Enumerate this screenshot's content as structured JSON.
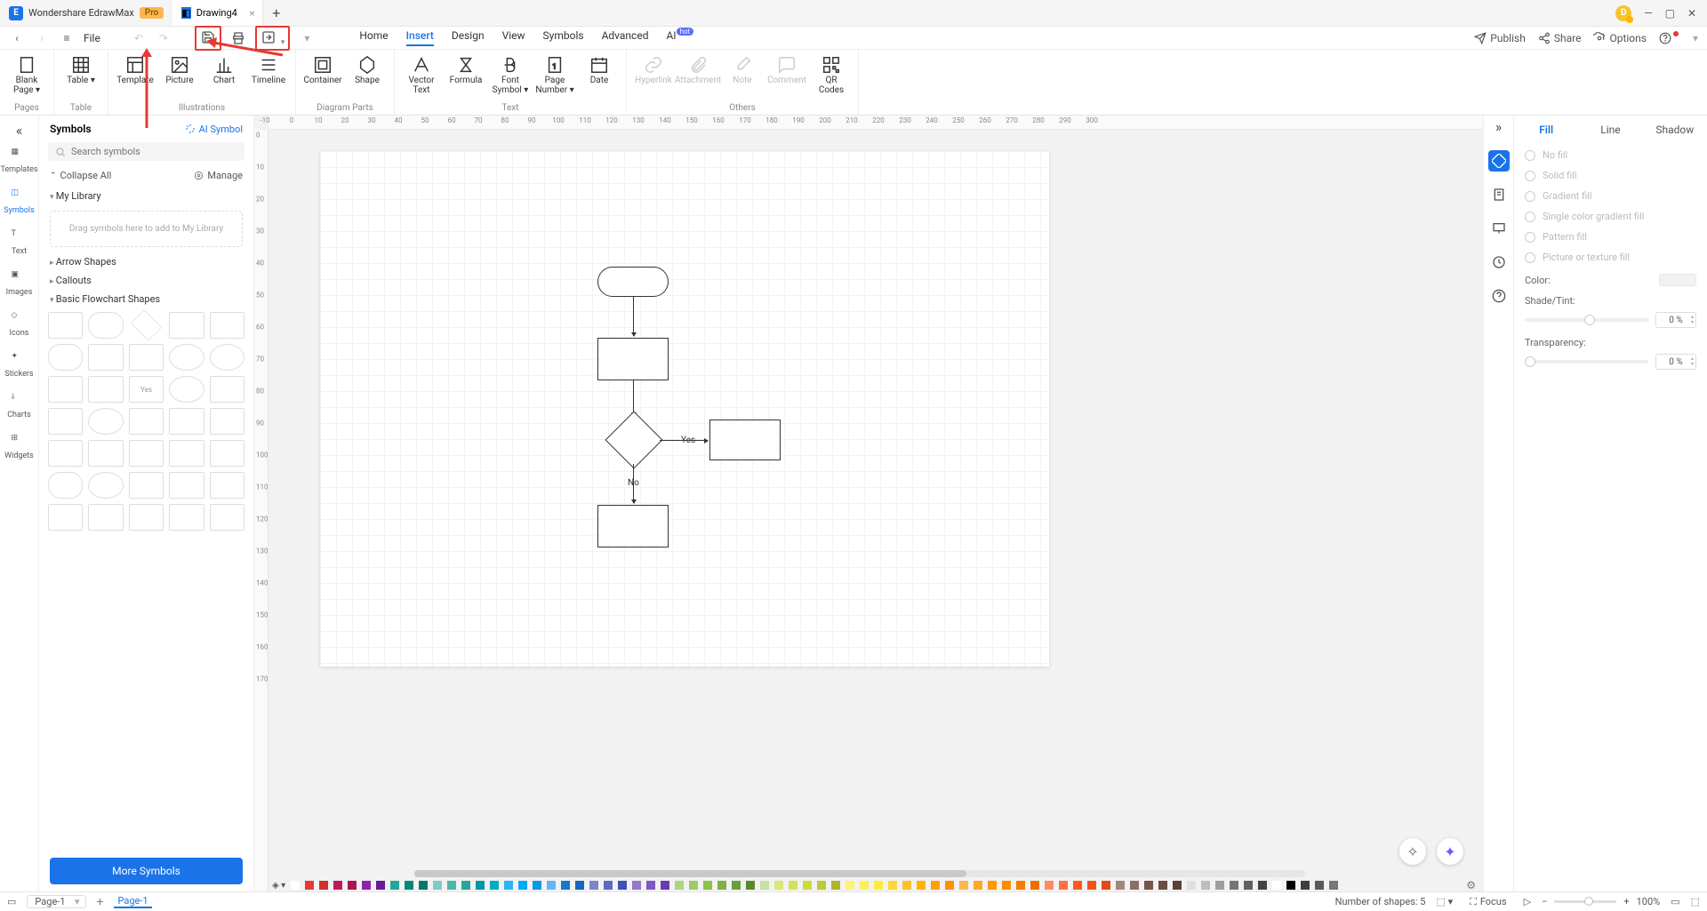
{
  "titlebar": {
    "app_name": "Wondershare EdrawMax",
    "pro_badge": "Pro",
    "doc_tab": "Drawing4",
    "avatar_initial": "D"
  },
  "menubar": {
    "file": "File",
    "tabs": [
      "Home",
      "Insert",
      "Design",
      "View",
      "Symbols",
      "Advanced",
      "AI"
    ],
    "active_tab_index": 1,
    "hot_badge": "hot",
    "right": {
      "publish": "Publish",
      "share": "Share",
      "options": "Options"
    }
  },
  "ribbon": {
    "groups": [
      {
        "label": "Pages",
        "items": [
          {
            "label": "Blank\nPage",
            "dd": true
          }
        ]
      },
      {
        "label": "Table",
        "items": [
          {
            "label": "Table",
            "dd": true
          }
        ]
      },
      {
        "label": "Illustrations",
        "items": [
          {
            "label": "Template"
          },
          {
            "label": "Picture"
          },
          {
            "label": "Chart"
          },
          {
            "label": "Timeline"
          }
        ]
      },
      {
        "label": "Diagram Parts",
        "items": [
          {
            "label": "Container"
          },
          {
            "label": "Shape"
          }
        ]
      },
      {
        "label": "Text",
        "items": [
          {
            "label": "Vector\nText"
          },
          {
            "label": "Formula"
          },
          {
            "label": "Font\nSymbol",
            "dd": true
          },
          {
            "label": "Page\nNumber",
            "dd": true
          },
          {
            "label": "Date"
          }
        ]
      },
      {
        "label": "Others",
        "items": [
          {
            "label": "Hyperlink",
            "disabled": true
          },
          {
            "label": "Attachment",
            "disabled": true
          },
          {
            "label": "Note",
            "disabled": true
          },
          {
            "label": "Comment",
            "disabled": true
          },
          {
            "label": "QR\nCodes"
          }
        ]
      }
    ]
  },
  "left_rail": {
    "items": [
      "Templates",
      "Symbols",
      "Text",
      "Images",
      "Icons",
      "Stickers",
      "Charts",
      "Widgets"
    ],
    "active_index": 1
  },
  "symbols_panel": {
    "title": "Symbols",
    "ai_symbol": "AI Symbol",
    "search_placeholder": "Search symbols",
    "collapse_all": "Collapse All",
    "manage": "Manage",
    "my_library": "My Library",
    "drop_hint": "Drag symbols here to add to My Library",
    "sections": [
      "Arrow Shapes",
      "Callouts",
      "Basic Flowchart Shapes"
    ],
    "more": "More Symbols"
  },
  "ruler_h": [
    "-10",
    "0",
    "10",
    "20",
    "30",
    "40",
    "50",
    "60",
    "70",
    "80",
    "90",
    "100",
    "110",
    "120",
    "130",
    "140",
    "150",
    "160",
    "170",
    "180",
    "190",
    "200",
    "210",
    "220",
    "230",
    "240",
    "250",
    "260",
    "270",
    "280",
    "290",
    "300"
  ],
  "ruler_v": [
    "0",
    "10",
    "20",
    "30",
    "40",
    "50",
    "60",
    "70",
    "80",
    "90",
    "100",
    "110",
    "120",
    "130",
    "140",
    "150",
    "160",
    "170"
  ],
  "canvas": {
    "labels": {
      "yes": "Yes",
      "no": "No"
    }
  },
  "right_rail_tabs": [
    "Fill",
    "Line",
    "Shadow"
  ],
  "right_rail_active": 0,
  "fill_panel": {
    "options": [
      "No fill",
      "Solid fill",
      "Gradient fill",
      "Single color gradient fill",
      "Pattern fill",
      "Picture or texture fill"
    ],
    "color_label": "Color:",
    "shade_label": "Shade/Tint:",
    "shade_value": "0 %",
    "transparency_label": "Transparency:",
    "transparency_value": "0 %"
  },
  "statusbar": {
    "page_selector": "Page-1",
    "page_tab": "Page-1",
    "shape_count": "Number of shapes: 5",
    "focus": "Focus",
    "zoom": "100%"
  },
  "palette": [
    "#ffffff",
    "#e53935",
    "#d32f2f",
    "#c2185b",
    "#ad1457",
    "#8e24aa",
    "#6a1b9a",
    "#26a69a",
    "#00897b",
    "#00796b",
    "#80cbc4",
    "#4db6ac",
    "#26a69a",
    "#0097a7",
    "#00acc1",
    "#29b6f6",
    "#03a9f4",
    "#039be5",
    "#64b5f6",
    "#1976d2",
    "#1565c0",
    "#7986cb",
    "#5c6bc0",
    "#3f51b5",
    "#9575cd",
    "#7e57c2",
    "#673ab7",
    "#aed581",
    "#9ccc65",
    "#8bc34a",
    "#7cb342",
    "#689f38",
    "#558b2f",
    "#c5e1a5",
    "#dce775",
    "#d4e157",
    "#cddc39",
    "#c0ca33",
    "#afb42b",
    "#fff176",
    "#ffee58",
    "#ffeb3b",
    "#fdd835",
    "#fbc02d",
    "#ffb300",
    "#ffa000",
    "#ff8f00",
    "#ffb74d",
    "#ffa726",
    "#ff9800",
    "#fb8c00",
    "#f57c00",
    "#ef6c00",
    "#ff8a65",
    "#ff7043",
    "#ff5722",
    "#f4511e",
    "#e64a19",
    "#a1887f",
    "#8d6e63",
    "#795548",
    "#6d4c41",
    "#5d4037",
    "#e0e0e0",
    "#bdbdbd",
    "#9e9e9e",
    "#757575",
    "#616161",
    "#424242",
    "#ffffff",
    "#000000",
    "#3e3e3e",
    "#5a5a5a",
    "#777777"
  ]
}
